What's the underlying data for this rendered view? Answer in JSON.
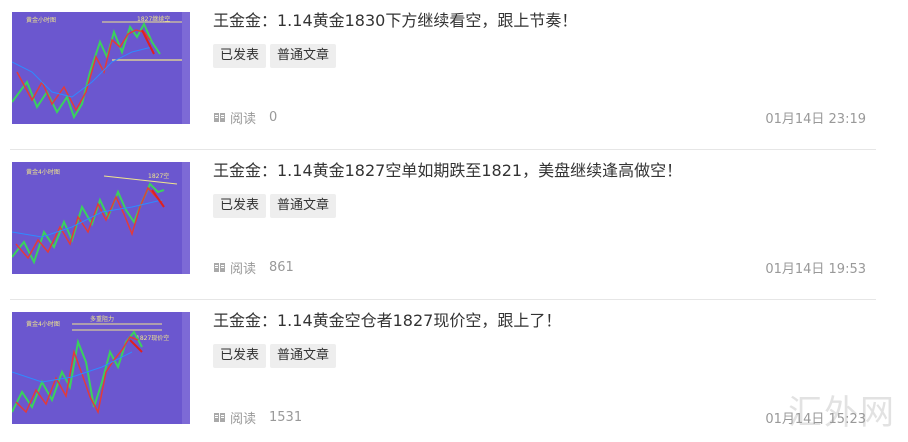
{
  "articles": [
    {
      "title": "王金金：1.14黄金1830下方继续看空，跟上节奏！",
      "tags": [
        "已发表",
        "普通文章"
      ],
      "read_label": "阅读",
      "read_count": "0",
      "date": "01月14日 23:19",
      "thumb": {
        "chart_title": "黄金小时图",
        "annotation": "1827继续空"
      }
    },
    {
      "title": "王金金：1.14黄金1827空单如期跌至1821，美盘继续逢高做空！",
      "tags": [
        "已发表",
        "普通文章"
      ],
      "read_label": "阅读",
      "read_count": "861",
      "date": "01月14日 19:53",
      "thumb": {
        "chart_title": "黄金4小时图",
        "annotation": "1827空"
      }
    },
    {
      "title": "王金金：1.14黄金空仓者1827现价空，跟上了！",
      "tags": [
        "已发表",
        "普通文章"
      ],
      "read_label": "阅读",
      "read_count": "1531",
      "date": "01月14日 15:23",
      "thumb": {
        "chart_title": "黄金4小时图",
        "annotation": "1827现价空",
        "annotation2": "多重阻力"
      }
    }
  ],
  "watermark": "汇外网",
  "colors": {
    "thumb_bg": "#6b57cf",
    "tag_bg": "#eeeeee",
    "meta_text": "#999999",
    "divider": "#e6e6e6"
  }
}
